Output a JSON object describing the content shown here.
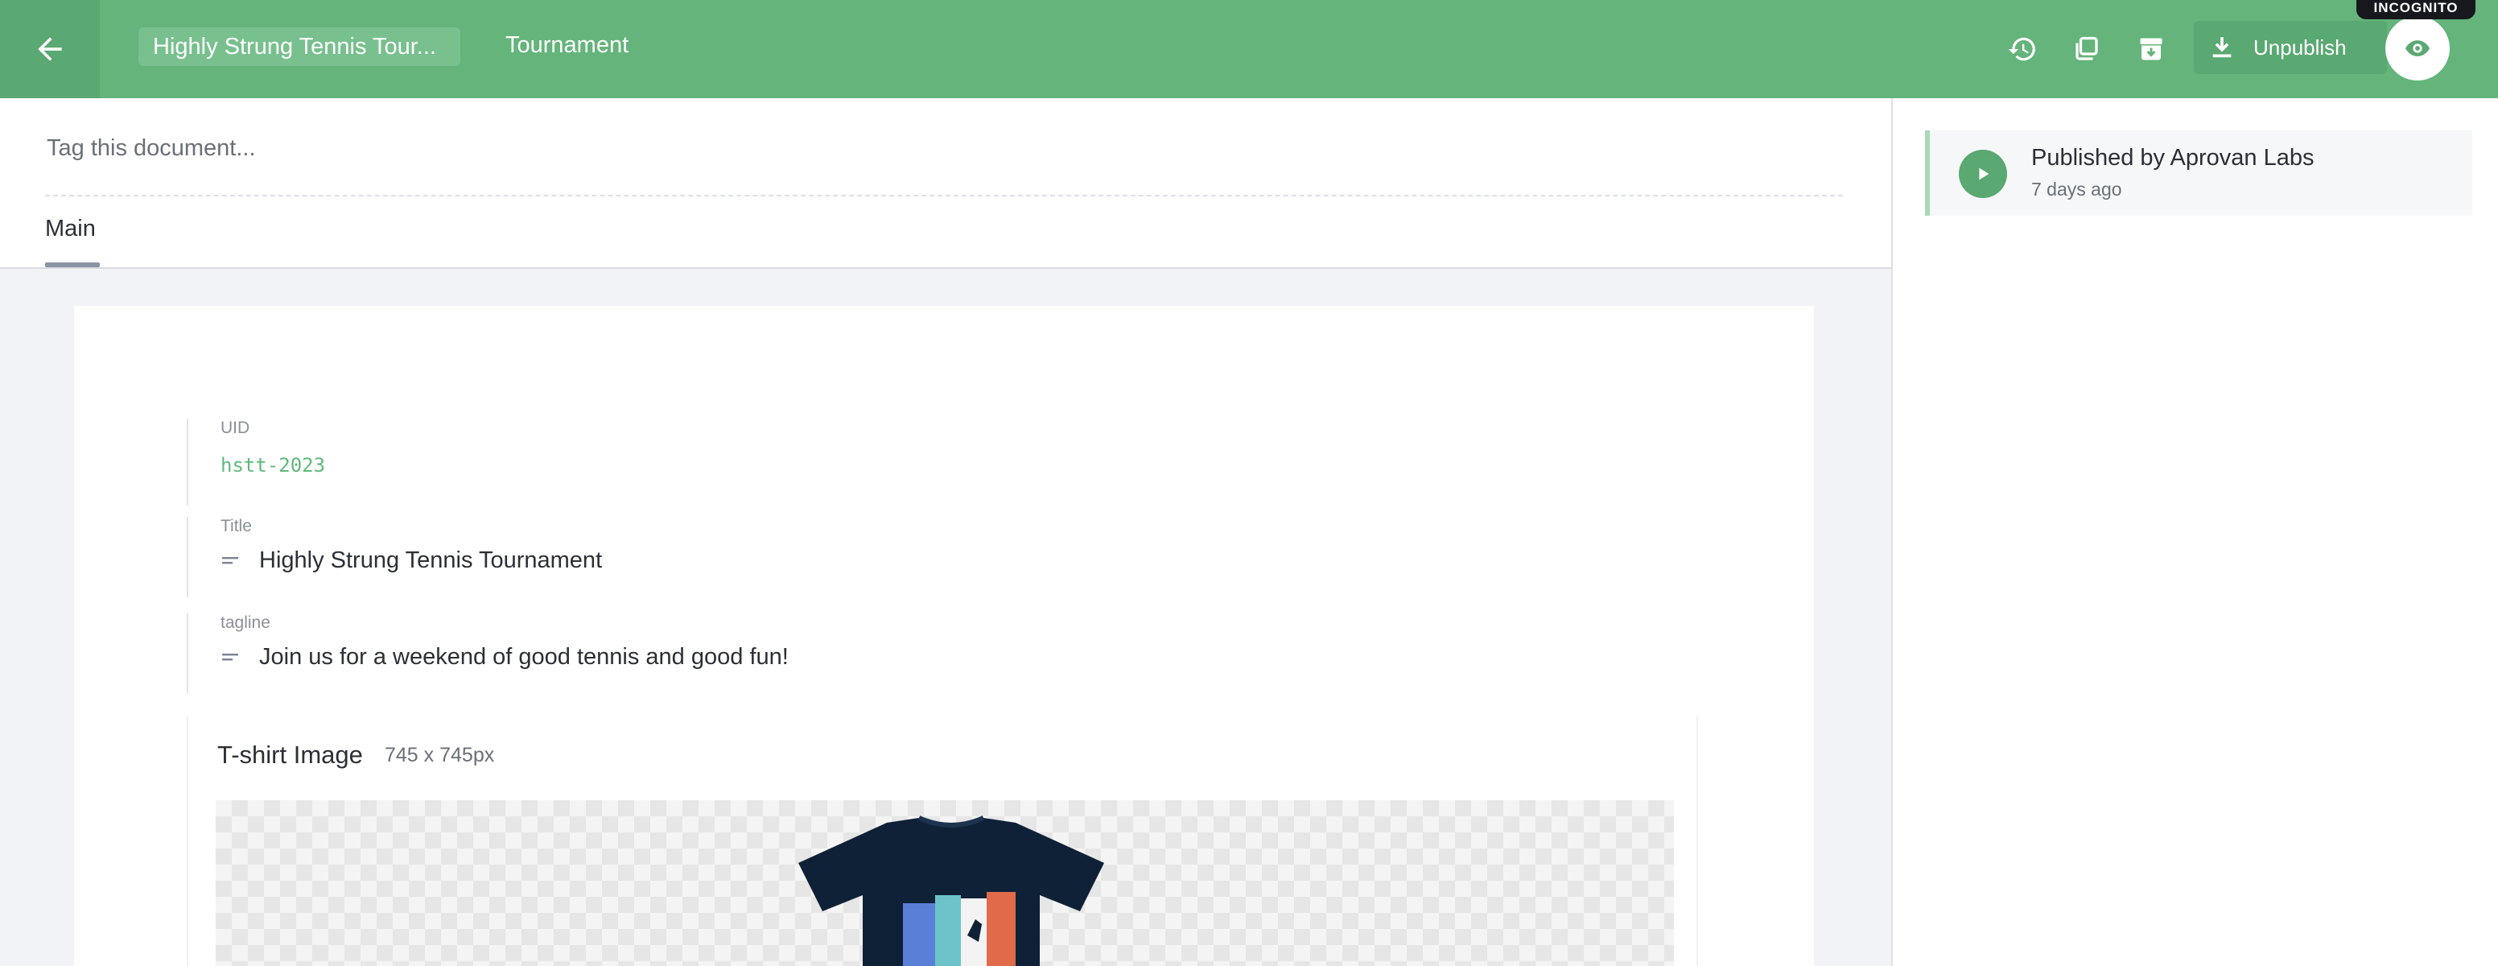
{
  "topbar": {
    "document_title": "Highly Strung Tennis Tour...",
    "document_type": "Tournament",
    "unpublish_label": "Unpublish",
    "incognito_label": "INCOGNITO",
    "icons": [
      "arrow-left-icon",
      "history-icon",
      "duplicate-icon",
      "archive-icon",
      "download-icon",
      "eye-icon"
    ]
  },
  "editor": {
    "tag_placeholder": "Tag this document...",
    "tabs": [
      {
        "label": "Main",
        "active": true
      }
    ],
    "fields": {
      "uid": {
        "label": "UID",
        "value": "hstt-2023"
      },
      "title": {
        "label": "Title",
        "value": "Highly Strung Tennis Tournament"
      },
      "tagline": {
        "label": "tagline",
        "value": "Join us for a weekend of good tennis and good fun!"
      },
      "image": {
        "label": "T-shirt Image",
        "dimensions": "745 x 745px"
      }
    }
  },
  "sidebar": {
    "status_title": "Published by Aprovan Labs",
    "status_time": "7 days ago"
  },
  "colors": {
    "topbar": "#64b47b",
    "accent": "#5fb97c",
    "panel_bg": "#f1f3f6"
  }
}
